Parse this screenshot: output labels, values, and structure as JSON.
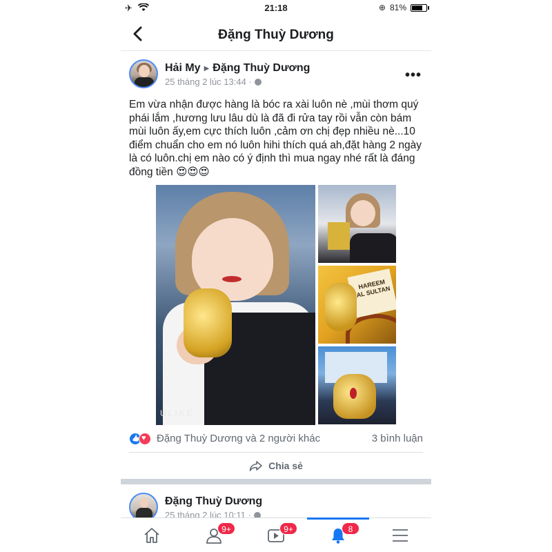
{
  "status_bar": {
    "time": "21:18",
    "battery": "81%",
    "battery_level": 0.81,
    "icons": [
      "airplane-icon",
      "wifi-icon",
      "rotation-lock-icon",
      "battery-icon"
    ]
  },
  "header": {
    "title": "Đặng Thuỳ Dương",
    "back_icon": "chevron-left-icon"
  },
  "post": {
    "author": "Hải My",
    "target": "Đặng Thuỳ Dương",
    "timestamp": "25 tháng 2 lúc 13:44 ·",
    "text": "Em vừa nhận được hàng là bóc ra xài luôn nè ,mùi thơm quý phái lắm ,hương lưu lâu dù là đã đi rửa tay rồi vẫn còn bám mùi luôn ấy,em cực thích luôn ,cảm ơn chị đẹp nhiều nè...10 điểm chuẩn cho em nó luôn hihi thích quá ah,đặt hàng 2 ngày là có luôn.chị em nào có ý định thì mua ngay nhé rất là đáng đồng tiền 😍😍😍",
    "photo_watermark": "ULIKE",
    "box_label": "HAREEM AL SULTAN",
    "reactions_names": "Đặng Thuỳ Dương và 2 người khác",
    "comments_count": "3 bình luận",
    "share_label": "Chia sẻ"
  },
  "post2": {
    "author": "Đặng Thuỳ Dương",
    "timestamp": "25 tháng 2 lúc 10:11 ·"
  },
  "tabbar": {
    "tabs": [
      {
        "name": "home",
        "icon": "home-icon",
        "badge": ""
      },
      {
        "name": "friends",
        "icon": "friends-icon",
        "badge": "9+"
      },
      {
        "name": "watch",
        "icon": "video-icon",
        "badge": "9+"
      },
      {
        "name": "notifications",
        "icon": "bell-icon",
        "badge": "8",
        "active": true
      },
      {
        "name": "menu",
        "icon": "menu-icon",
        "badge": ""
      }
    ]
  },
  "colors": {
    "accent": "#1877f2",
    "badge": "#f02849",
    "like": "#1877f2",
    "love": "#f33e58"
  }
}
